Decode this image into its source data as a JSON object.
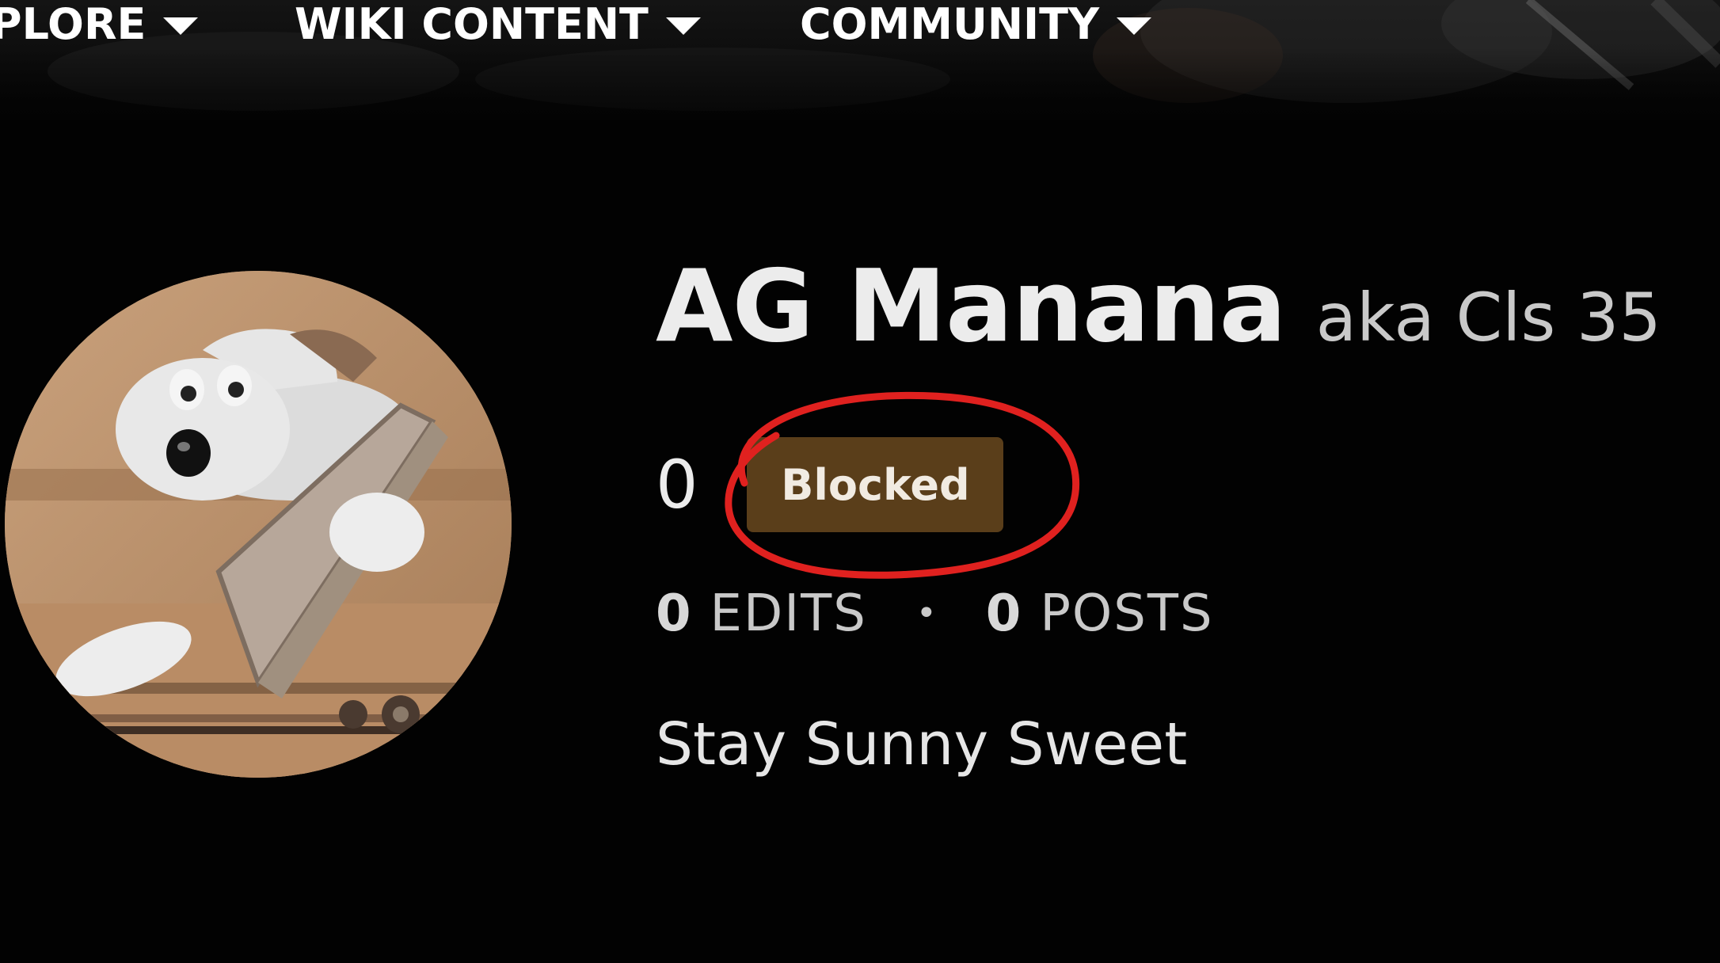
{
  "nav": {
    "items": [
      {
        "label": "PLORE",
        "icon": "chevron-down-icon"
      },
      {
        "label": "WIKI CONTENT",
        "icon": "chevron-down-icon"
      },
      {
        "label": "COMMUNITY",
        "icon": "chevron-down-icon"
      }
    ]
  },
  "profile": {
    "username": "AG Manana",
    "aka": "aka Cls 35",
    "rank": "0",
    "badge": "Blocked",
    "edits_count": "0",
    "edits_label": "EDITS",
    "separator": "•",
    "posts_count": "0",
    "posts_label": "POSTS",
    "bio": "Stay Sunny Sweet"
  },
  "colors": {
    "background": "#020202",
    "badge_bg": "#5a3e1a",
    "annotation": "#e0211f",
    "text": "#ececec"
  }
}
